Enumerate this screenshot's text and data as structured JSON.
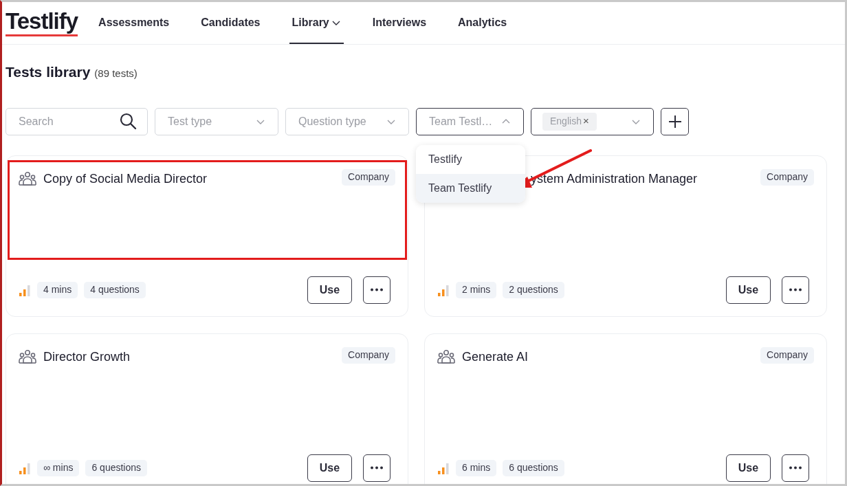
{
  "logo": {
    "text": "Testlify"
  },
  "nav": [
    {
      "label": "Assessments",
      "selected": false,
      "dropdown": false
    },
    {
      "label": "Candidates",
      "selected": false,
      "dropdown": false
    },
    {
      "label": "Library",
      "selected": true,
      "dropdown": true
    },
    {
      "label": "Interviews",
      "selected": false,
      "dropdown": false
    },
    {
      "label": "Analytics",
      "selected": false,
      "dropdown": false
    }
  ],
  "page": {
    "title": "Tests library",
    "count": "(89 tests)"
  },
  "filters": [
    {
      "kind": "search",
      "placeholder": "Search"
    },
    {
      "kind": "select",
      "placeholder": "Test type",
      "open": false
    },
    {
      "kind": "select",
      "placeholder": "Question type",
      "open": false
    },
    {
      "kind": "select",
      "placeholder": "Team Testl…",
      "open": true
    },
    {
      "kind": "tags",
      "chips": [
        {
          "label": "English",
          "remove": "×"
        }
      ],
      "open": false
    },
    {
      "kind": "add"
    }
  ],
  "dropdown": {
    "options": [
      {
        "label": "Testlify",
        "selected": false
      },
      {
        "label": "Team Testlify",
        "selected": true
      }
    ]
  },
  "cards": [
    {
      "title": "Copy of Social Media Director",
      "badge": "Company",
      "covered": false,
      "highlighted": true,
      "duration": "4 mins",
      "questions": "4 questions",
      "action": "Use"
    },
    {
      "title": "ystem Administration Manager",
      "badge": "Company",
      "covered": true,
      "highlighted": false,
      "duration": "2 mins",
      "questions": "2 questions",
      "action": "Use"
    },
    {
      "title": "Director Growth",
      "badge": "Company",
      "covered": false,
      "highlighted": false,
      "duration": "∞ mins",
      "questions": "6 questions",
      "action": "Use"
    },
    {
      "title": "Generate AI",
      "badge": "Company",
      "covered": false,
      "highlighted": false,
      "duration": "6 mins",
      "questions": "6 questions",
      "action": "Use"
    }
  ]
}
